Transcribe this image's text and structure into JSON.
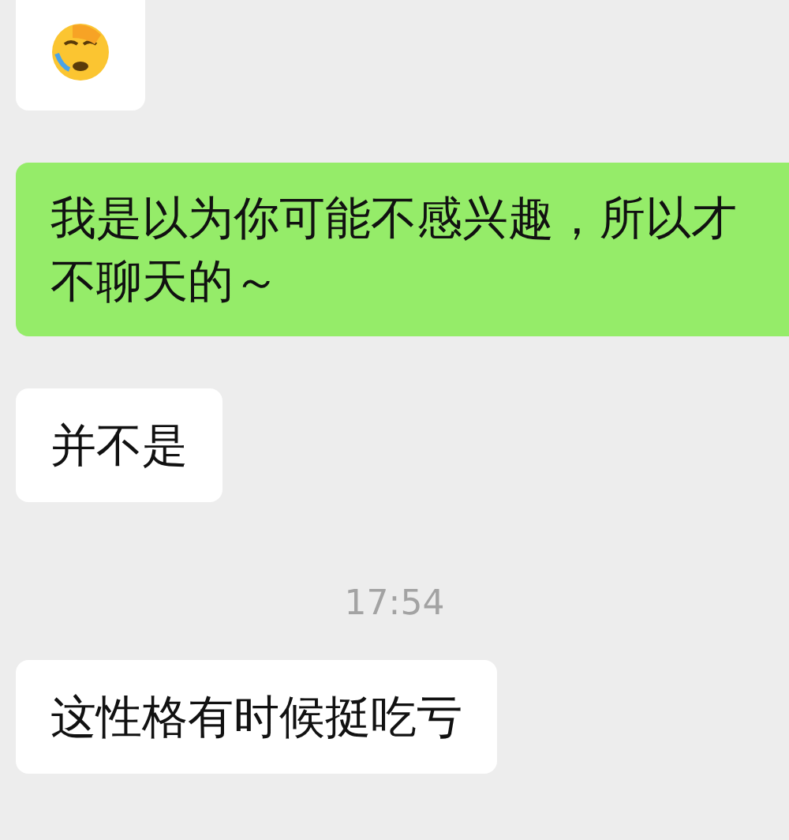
{
  "messages": [
    {
      "kind": "emoji",
      "outgoing": false
    },
    {
      "kind": "text",
      "outgoing": true,
      "text": "我是以为你可能不感兴趣，所以才不聊天的～"
    },
    {
      "kind": "text",
      "outgoing": false,
      "text": "并不是"
    },
    {
      "kind": "time",
      "text": "17:54"
    },
    {
      "kind": "text",
      "outgoing": false,
      "text": "这性格有时候挺吃亏"
    }
  ]
}
